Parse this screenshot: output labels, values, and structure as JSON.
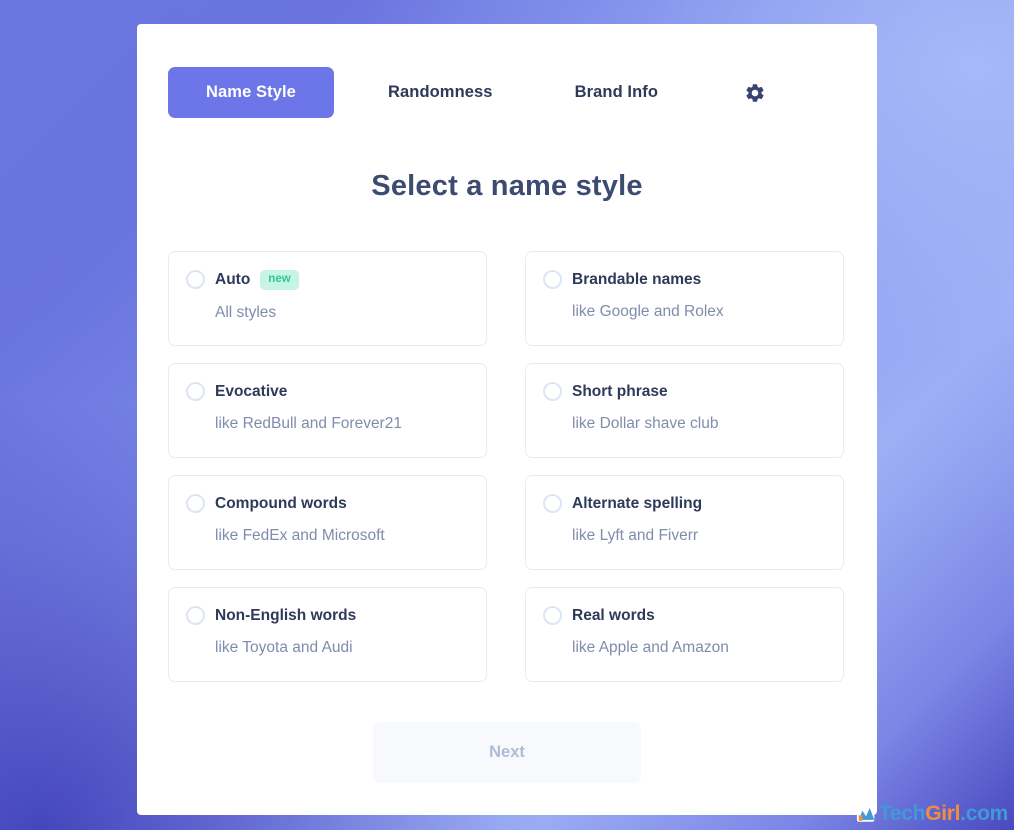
{
  "background": {
    "gradient_from": "#6f79e0",
    "gradient_mid": "#9fb0f5",
    "gradient_to": "#4a49bf"
  },
  "theme": {
    "accent": "#6c76e8",
    "heading_color": "#3d4a72",
    "label_color": "#2e3a59",
    "subtext_color": "#7f8cab",
    "card_border": "#e6ecf7",
    "badge_bg": "#c6f5e3",
    "badge_text": "#2fc79a",
    "next_bg": "#f8f9fd",
    "next_text": "#aebcd8"
  },
  "tabs": [
    {
      "label": "Name Style",
      "active": true
    },
    {
      "label": "Randomness",
      "active": false
    },
    {
      "label": "Brand Info",
      "active": false
    }
  ],
  "settings_icon": "gear-icon",
  "heading": "Select a name style",
  "options": [
    {
      "label": "Auto",
      "badge": "new",
      "sub": "All styles",
      "selected": false,
      "column": "left"
    },
    {
      "label": "Brandable names",
      "badge": null,
      "sub": "like Google and Rolex",
      "selected": false,
      "column": "right"
    },
    {
      "label": "Evocative",
      "badge": null,
      "sub": "like RedBull and Forever21",
      "selected": false,
      "column": "left"
    },
    {
      "label": "Short phrase",
      "badge": null,
      "sub": "like Dollar shave club",
      "selected": false,
      "column": "right"
    },
    {
      "label": "Compound words",
      "badge": null,
      "sub": "like FedEx and Microsoft",
      "selected": false,
      "column": "left"
    },
    {
      "label": "Alternate spelling",
      "badge": null,
      "sub": "like Lyft and Fiverr",
      "selected": false,
      "column": "right"
    },
    {
      "label": "Non-English words",
      "badge": null,
      "sub": "like Toyota and Audi",
      "selected": false,
      "column": "left"
    },
    {
      "label": "Real words",
      "badge": null,
      "sub": "like Apple and Amazon",
      "selected": false,
      "column": "right"
    }
  ],
  "next_button": {
    "label": "Next",
    "enabled": false
  },
  "watermark": {
    "mark": "M",
    "part1": "Tech",
    "part2": "Girl",
    "part3": ".com"
  }
}
